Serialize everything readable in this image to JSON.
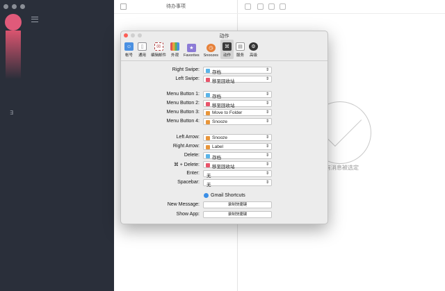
{
  "app": {
    "list_title": "待办事项",
    "sidebar_glyph": "∃",
    "empty_state": "有消息被选定"
  },
  "dialog": {
    "title": "动作",
    "tabs": [
      {
        "label": "帐号",
        "icon": "account-icon",
        "color": "#4a90e2"
      },
      {
        "label": "通用",
        "icon": "phone-icon",
        "color": "#8e8e93"
      },
      {
        "label": "编辑邮件",
        "icon": "compose-icon",
        "color": "#b0b0b0"
      },
      {
        "label": "外观",
        "icon": "pencils-icon",
        "color": "#e8a33c"
      },
      {
        "label": "Favorites",
        "icon": "folder-star-icon",
        "color": "#8c7bd6"
      },
      {
        "label": "Snoozes",
        "icon": "clock-icon",
        "color": "#e6813a"
      },
      {
        "label": "动作",
        "icon": "command-icon",
        "color": "#3a3a3a"
      },
      {
        "label": "服务",
        "icon": "services-icon",
        "color": "#9a9a9a"
      },
      {
        "label": "高级",
        "icon": "advanced-icon",
        "color": "#333333"
      }
    ],
    "swipe": [
      {
        "label": "Right Swipe:",
        "value": "存档",
        "icon_color": "#5ab4e8"
      },
      {
        "label": "Left Swipe:",
        "value": "移至回收站",
        "icon_color": "#e8546a"
      }
    ],
    "menu_buttons": [
      {
        "label": "Menu Button 1:",
        "value": "存档",
        "icon_color": "#5ab4e8"
      },
      {
        "label": "Menu Button 2:",
        "value": "移至回收站",
        "icon_color": "#e8546a"
      },
      {
        "label": "Menu Button 3:",
        "value": "Move to Folder",
        "icon_color": "#e8953a"
      },
      {
        "label": "Menu Button 4:",
        "value": "Snooze",
        "icon_color": "#e8953a"
      }
    ],
    "keys": [
      {
        "label": "Left Arrow:",
        "value": "Snooze",
        "icon_color": "#e8953a"
      },
      {
        "label": "Right Arrow:",
        "value": "Label",
        "icon_color": "#e8953a"
      },
      {
        "label": "Delete:",
        "value": "存档",
        "icon_color": "#5ab4e8"
      },
      {
        "label": "⌘ + Delete:",
        "value": "移至回收站",
        "icon_color": "#e8546a"
      },
      {
        "label": "Enter:",
        "value": "无",
        "icon_color": ""
      },
      {
        "label": "Spacebar:",
        "value": "无",
        "icon_color": ""
      }
    ],
    "gmail_shortcuts_label": "Gmail Shortcuts",
    "shortcut_rows": [
      {
        "label": "New Message:",
        "button": "录制快捷键"
      },
      {
        "label": "Show App:",
        "button": "录制快捷键"
      }
    ]
  }
}
